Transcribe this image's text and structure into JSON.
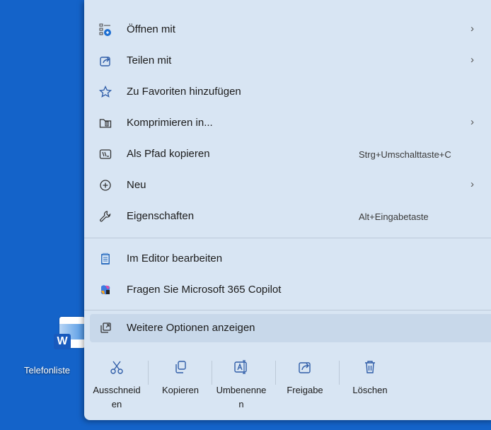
{
  "desktop": {
    "file_label": "Telefonliste",
    "icon": "word-document-icon",
    "badge_letter": "W"
  },
  "menu": {
    "items": [
      {
        "label": "Öffnen mit",
        "icon": "open-with-icon",
        "arrow": "›"
      },
      {
        "label": "Teilen mit",
        "icon": "share-with-icon",
        "arrow": "›"
      },
      {
        "label": "Zu Favoriten hinzufügen",
        "icon": "star-icon"
      },
      {
        "label": "Komprimieren in...",
        "icon": "compress-folder-icon",
        "arrow": "›"
      },
      {
        "label": "Als Pfad kopieren",
        "icon": "copy-path-icon",
        "shortcut": "Strg+Umschalttaste+C"
      },
      {
        "label": "Neu",
        "icon": "new-plus-icon",
        "arrow": "›"
      },
      {
        "label": "Eigenschaften",
        "icon": "wrench-icon",
        "shortcut": "Alt+Eingabetaste"
      },
      {
        "label": "Im Editor bearbeiten",
        "icon": "notepad-icon"
      },
      {
        "label": "Fragen Sie Microsoft 365 Copilot",
        "icon": "copilot-icon"
      },
      {
        "label": "Weitere Optionen anzeigen",
        "icon": "more-options-icon"
      }
    ],
    "actions": [
      {
        "label": "Ausschneiden",
        "icon": "scissors-icon"
      },
      {
        "label": "Kopieren",
        "icon": "copy-icon"
      },
      {
        "label": "Umbenennen",
        "icon": "rename-icon"
      },
      {
        "label": "Freigabe",
        "icon": "share-icon"
      },
      {
        "label": "Löschen",
        "icon": "trash-icon"
      }
    ]
  },
  "colors": {
    "desktop_bg": "#1463c9",
    "menu_bg": "#d8e5f3",
    "icon_accent": "#2f5da8"
  }
}
